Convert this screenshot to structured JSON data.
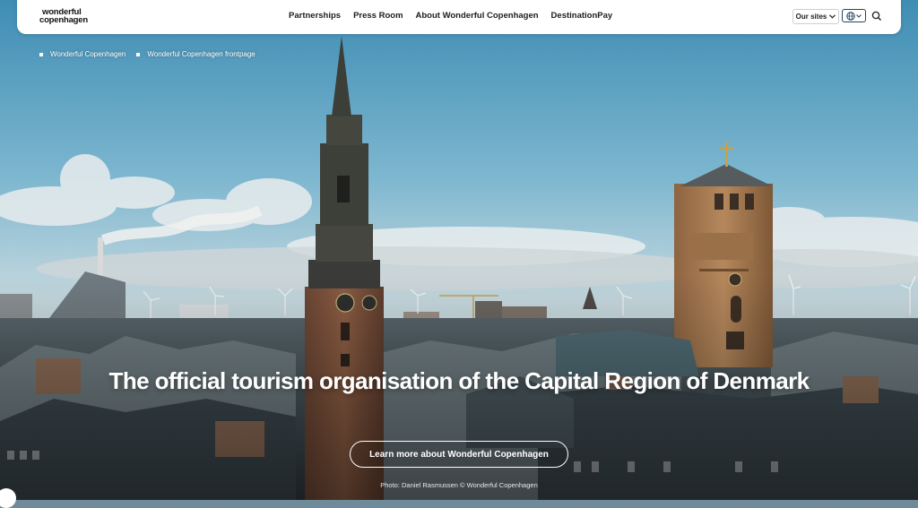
{
  "header": {
    "logo_line1": "wonderful",
    "logo_line2": "copenhagen",
    "nav": [
      "Partnerships",
      "Press Room",
      "About Wonderful Copenhagen",
      "DestinationPay"
    ],
    "our_sites_label": "Our sites"
  },
  "breadcrumb": [
    "Wonderful Copenhagen",
    "Wonderful Copenhagen frontpage"
  ],
  "hero": {
    "headline": "The official tourism organisation of the Capital Region of Denmark",
    "cta_label": "Learn more about Wonderful Copenhagen",
    "photo_credit": "Photo: Daniel Rasmussen © Wonderful Copenhagen"
  },
  "icons": {
    "our_sites_chevron": "chevron-down-icon",
    "language": "globe-icon",
    "search": "search-icon",
    "breadcrumb_bullet": "square-bullet"
  },
  "colors": {
    "nav_bg": "#ffffff",
    "text_dark": "#1d1d1d",
    "accent_border": "#24465c",
    "hero_text": "#ffffff"
  }
}
